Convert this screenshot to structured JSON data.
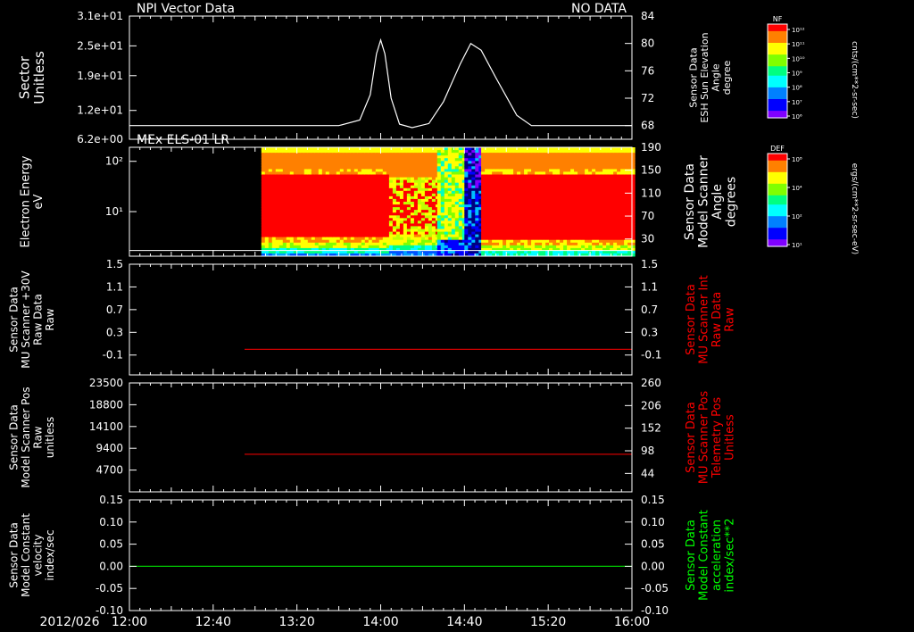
{
  "date_label": "2012/026",
  "time_ticks": [
    "12:00",
    "12:40",
    "13:20",
    "14:00",
    "14:40",
    "15:20",
    "16:00"
  ],
  "time_range": [
    0,
    240
  ],
  "time_tick_values": [
    0,
    40,
    80,
    120,
    160,
    200,
    240
  ],
  "colors": {
    "trace_white": "#ffffff",
    "trace_red": "#cc0000",
    "label_red": "#ff0000",
    "trace_green": "#00cc00",
    "label_green": "#00ff00"
  },
  "colorbars": [
    {
      "tag": "NF",
      "unit": "cnts/(cm**2-sr-sec)",
      "ticks": [
        "10¹²",
        "10¹¹",
        "10¹⁰",
        "10⁹",
        "10⁸",
        "10⁷",
        "10⁶"
      ]
    },
    {
      "tag": "DEF",
      "unit": "ergs/(cm**2-sr-sec-eV)",
      "ticks": [
        "10⁸",
        "10⁴",
        "10²",
        "10¹"
      ]
    }
  ],
  "chart_data": [
    {
      "type": "line",
      "title": "NPI Vector Data",
      "annotation": "NO DATA",
      "ylabel": [
        "Sector",
        "Unitless"
      ],
      "ylabel_right": [
        "Sensor Data",
        "ESH Sun Elevation",
        "Angle",
        "degree"
      ],
      "yticks": [
        "3.1e+01",
        "2.5e+01",
        "1.9e+01",
        "1.2e+01",
        "6.2e+00"
      ],
      "ytick_values": [
        31,
        25,
        19,
        12,
        6.2
      ],
      "ylim": [
        6.2,
        31
      ],
      "yticks_right": [
        "84",
        "80",
        "76",
        "72",
        "68"
      ],
      "ytick_right_values": [
        84,
        80,
        76,
        72,
        68
      ],
      "ylim_right": [
        66,
        84
      ],
      "axis": "right",
      "series": [
        {
          "color": "#ffffff",
          "x": [
            0,
            100,
            110,
            115,
            118,
            120,
            122,
            125,
            129,
            135,
            143,
            150,
            158,
            163,
            168,
            175,
            185,
            192,
            200,
            240
          ],
          "y": [
            68,
            68,
            68.8,
            72.5,
            78.5,
            80.5,
            78.5,
            72,
            68.2,
            67.7,
            68.3,
            71.5,
            77,
            80,
            79,
            75,
            69.5,
            68,
            68,
            68
          ]
        }
      ]
    },
    {
      "type": "heatmap",
      "title": "MEx ELS-01 LR",
      "ylabel": [
        "Electron Energy",
        "eV"
      ],
      "ylabel_right": [
        "Sensor Data",
        "Model Scanner",
        "Angle",
        "degrees"
      ],
      "yticks": [
        "10²",
        "10¹"
      ],
      "ytick_values": [
        100,
        10
      ],
      "ylim": [
        1.3,
        190
      ],
      "yscale": "log",
      "yticks_right": [
        "190",
        "150",
        "110",
        "70",
        "30"
      ],
      "ytick_right_values": [
        190,
        150,
        110,
        70,
        30
      ],
      "ylim_right": [
        0,
        190
      ],
      "data_start": 63,
      "line_value_right": 10,
      "segments": [
        {
          "from": 63,
          "to": 124,
          "red_low": 25,
          "red_high": 150
        },
        {
          "from": 124,
          "to": 147,
          "red_low": 30,
          "red_high": 140,
          "patchy": true
        },
        {
          "from": 147,
          "to": 160,
          "red_low": 60,
          "red_high": 130,
          "sparse": true
        },
        {
          "from": 160,
          "to": 168,
          "red_low": 190,
          "red_high": 190,
          "dropout": true
        },
        {
          "from": 168,
          "to": 240,
          "red_low": 20,
          "red_high": 150
        }
      ]
    },
    {
      "type": "line",
      "title": "",
      "ylabel": [
        "Sensor Data",
        "MU Scanner +30V",
        "Raw Data",
        "Raw"
      ],
      "ylabel_right": [
        "Sensor Data",
        "MU Scanner Int",
        "Raw Data",
        "Raw"
      ],
      "ylabel_right_color": "#ff0000",
      "yticks": [
        "1.5",
        "1.1",
        "0.7",
        "0.3",
        "-0.1"
      ],
      "ytick_values": [
        1.5,
        1.1,
        0.7,
        0.3,
        -0.1
      ],
      "ylim": [
        -0.45,
        1.5
      ],
      "yticks_right": [
        "1.5",
        "1.1",
        "0.7",
        "0.3",
        "-0.1"
      ],
      "ytick_right_values": [
        1.5,
        1.1,
        0.7,
        0.3,
        -0.1
      ],
      "ylim_right": [
        -0.45,
        1.5
      ],
      "series": [
        {
          "color": "#cc0000",
          "x": [
            55,
            240
          ],
          "y": [
            0.0,
            0.0
          ]
        }
      ]
    },
    {
      "type": "line",
      "title": "",
      "ylabel": [
        "Sensor Data",
        "Model Scanner Pos",
        "Raw",
        "unitless"
      ],
      "ylabel_right": [
        "Sensor Data",
        "MU Scanner Pos",
        "Telemetry Pos",
        "Unitless"
      ],
      "ylabel_right_color": "#ff0000",
      "yticks": [
        "23500",
        "18800",
        "14100",
        "9400",
        "4700"
      ],
      "ytick_values": [
        23500,
        18800,
        14100,
        9400,
        4700
      ],
      "ylim": [
        0,
        23500
      ],
      "yticks_right": [
        "260",
        "206",
        "152",
        "98",
        "44"
      ],
      "ytick_right_values": [
        260,
        206,
        152,
        98,
        44
      ],
      "ylim_right": [
        0,
        260
      ],
      "series": [
        {
          "color": "#cc0000",
          "x": [
            55,
            240
          ],
          "y": [
            8100,
            8100
          ]
        }
      ]
    },
    {
      "type": "line",
      "title": "",
      "ylabel": [
        "Sensor Data",
        "Model Constant",
        "velocity",
        "index/sec"
      ],
      "ylabel_right": [
        "Sensor Data",
        "Model Constant",
        "acceleration",
        "index/sec**2"
      ],
      "ylabel_right_color": "#00ff00",
      "yticks": [
        "0.15",
        "0.10",
        "0.05",
        "0.00",
        "-0.05",
        "-0.10"
      ],
      "ytick_values": [
        0.15,
        0.1,
        0.05,
        0.0,
        -0.05,
        -0.1
      ],
      "ylim": [
        -0.1,
        0.15
      ],
      "yticks_right": [
        "0.15",
        "0.10",
        "0.05",
        "0.00",
        "-0.05",
        "-0.10"
      ],
      "ytick_right_values": [
        0.15,
        0.1,
        0.05,
        0.0,
        -0.05,
        -0.1
      ],
      "ylim_right": [
        -0.1,
        0.15
      ],
      "series": [
        {
          "color": "#00cc00",
          "x": [
            0,
            240
          ],
          "y": [
            0.0,
            0.0
          ]
        }
      ]
    }
  ]
}
